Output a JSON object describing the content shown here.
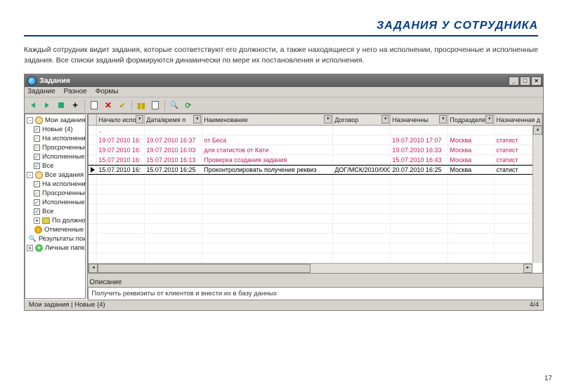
{
  "page": {
    "title": "ЗАДАНИЯ У СОТРУДНИКА",
    "body": "Каждый сотрудник видит задания, которые соответствуют его должности, а также находящиеся у него на исполнении, просроченные и исполненные задания. Все списки заданий формируются динамически по мере их постановления и исполнения.",
    "number": "17"
  },
  "window": {
    "title": "Задания",
    "menu": [
      "Задание",
      "Разное",
      "Формы"
    ]
  },
  "tree": {
    "root1": "Мои задания",
    "items1": [
      "Новые (4)",
      "На исполнении",
      "Просроченные",
      "Исполненные",
      "Все"
    ],
    "root2": "Все задания",
    "items2": [
      "На исполнении",
      "Просроченные",
      "Исполненные",
      "Все",
      "По должностям"
    ],
    "ext1": "Отмеченные",
    "ext2": "Результаты поиска",
    "ext3": "Личные папки"
  },
  "grid": {
    "columns": [
      "Начало испо",
      "Дата/время п",
      "Наименование",
      "Договор",
      "Назначенны",
      "Подразделени",
      "Назначенная д"
    ],
    "dots": "..",
    "rows": [
      {
        "c1": "19.07.2010 16:",
        "c2": "19.07.2010 16:37",
        "c3": "от Беса",
        "c4": "",
        "c5": "19.07.2010 17:07",
        "c6": "Москва",
        "c7": "статист",
        "pink": true
      },
      {
        "c1": "19.07.2010 16:",
        "c2": "19.07.2010 16:03",
        "c3": "для статистов от Кати",
        "c4": "",
        "c5": "19.07.2010 16:33",
        "c6": "Москва",
        "c7": "статист",
        "pink": true
      },
      {
        "c1": "15.07.2010 16:",
        "c2": "15.07.2010 16:13",
        "c3": "Проверка создания задания",
        "c4": "",
        "c5": "15.07.2010 16:43",
        "c6": "Москва",
        "c7": "статист",
        "pink": true
      },
      {
        "c1": "15.07.2010 16:",
        "c2": "15.07.2010 16:25",
        "c3": "Проконтролировать получение реквиз",
        "c4": "ДОГ/МСК/2010/000",
        "c5": "20.07.2010 16:25",
        "c6": "Москва",
        "c7": "статист",
        "pink": false,
        "sel": true
      }
    ]
  },
  "desc": {
    "label": "Описание",
    "text": "Получить реквизиты от клиентов и внести их в базу данных"
  },
  "status": {
    "left": "Мои задания | Новые (4)",
    "right": "4/4"
  }
}
